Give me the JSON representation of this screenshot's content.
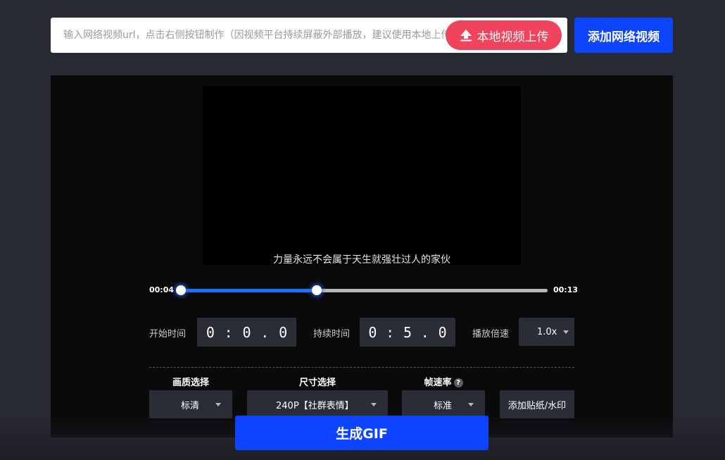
{
  "url_bar": {
    "placeholder": "输入网络视频url，点击右侧按钮制作（因视频平台持续屏蔽外部播放，建议使用本地上传）",
    "upload_label": "本地视频上传"
  },
  "add_network_label": "添加网络视频",
  "video": {
    "subtitle": "力量永远不会属于天生就强壮过人的家伙"
  },
  "timeline": {
    "start_label": "00:04",
    "end_label": "00:13",
    "range_start_fraction": 0.0,
    "range_end_fraction": 0.37
  },
  "controls": {
    "start_time_label": "开始时间",
    "start_time": [
      "0",
      ":",
      "0",
      ".",
      "0"
    ],
    "duration_label": "持续时间",
    "duration": [
      "0",
      ":",
      "5",
      ".",
      "0"
    ],
    "speed_label": "播放倍速",
    "speed_value": "1.0x"
  },
  "options": {
    "quality_label": "画质选择",
    "quality_value": "标清",
    "size_label": "尺寸选择",
    "size_value": "240P【社群表情】",
    "fps_label": "帧速率",
    "fps_help": "?",
    "fps_value": "标准",
    "sticker_label": "添加贴纸/水印"
  },
  "generate_label": "生成GIF",
  "colors": {
    "accent": "#0c44ff",
    "upload": "#f0445c",
    "track_fill": "#1a73ff"
  }
}
